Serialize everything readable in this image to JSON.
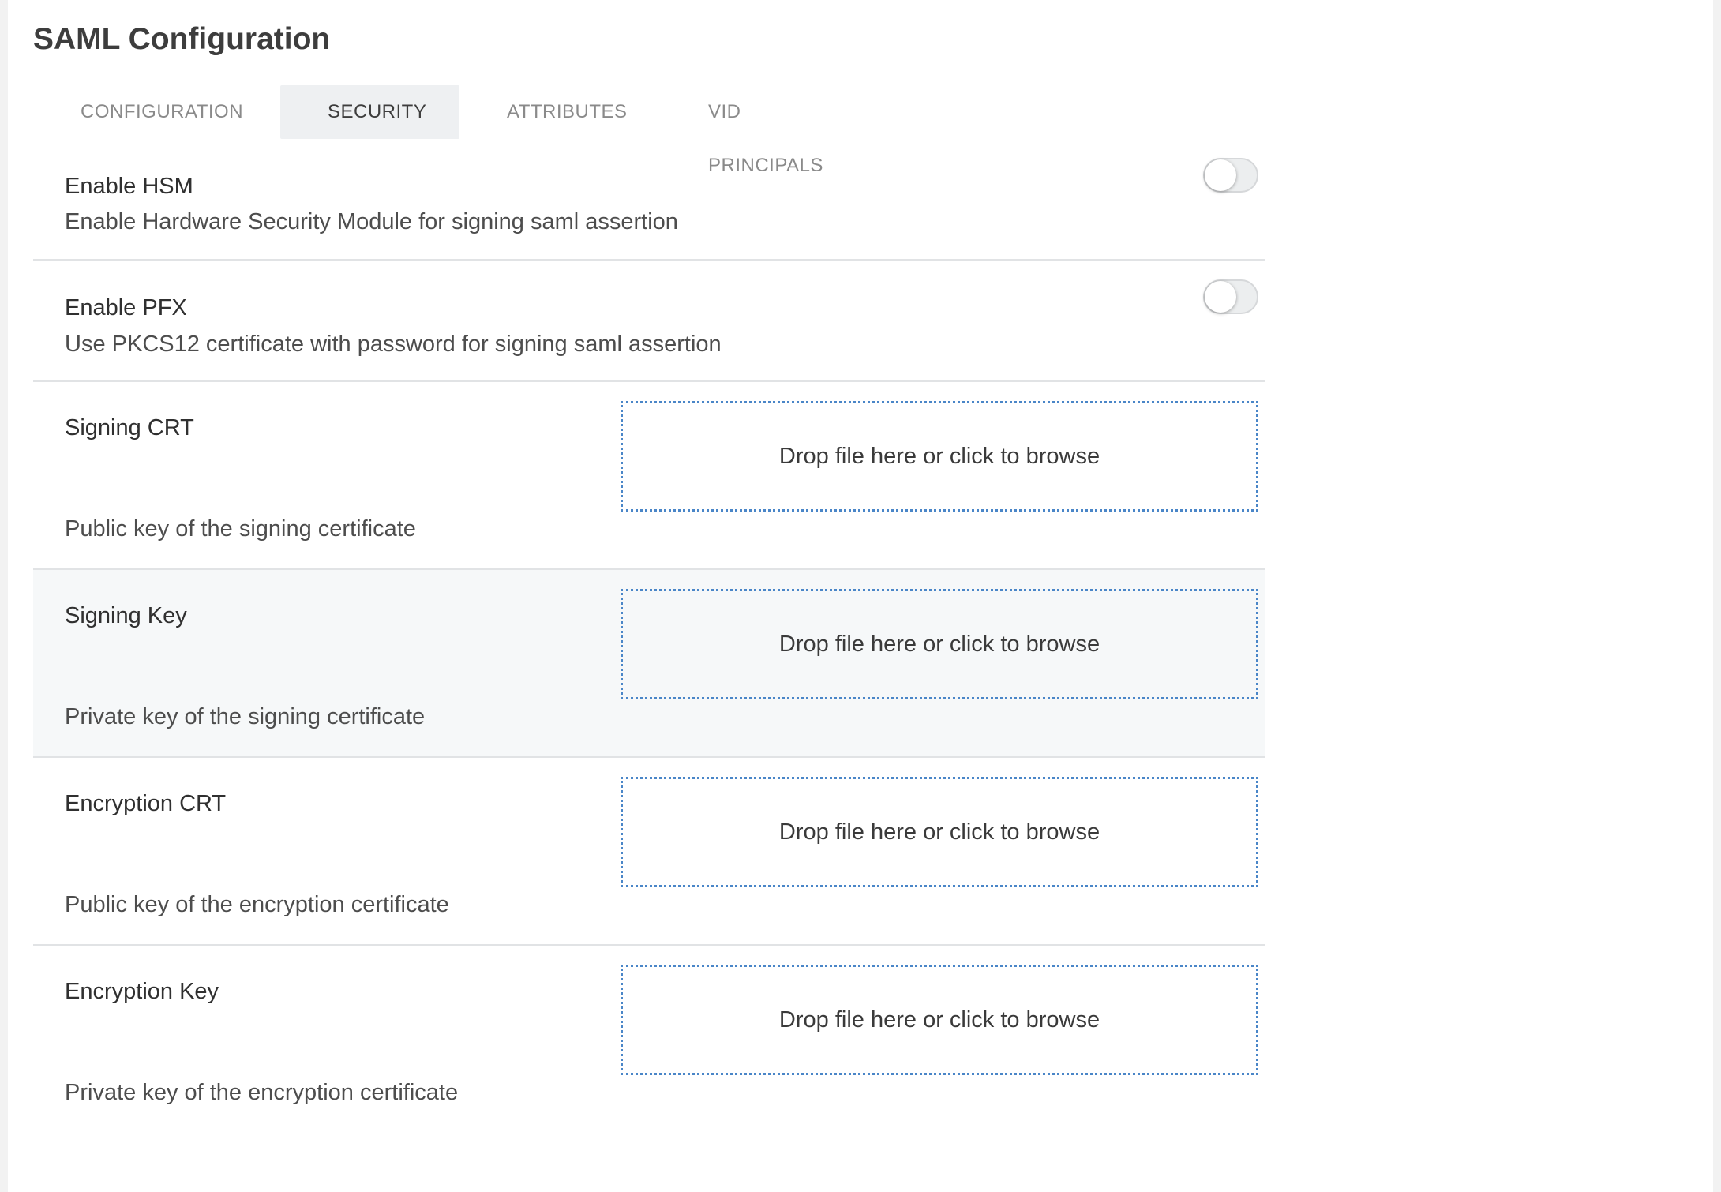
{
  "page": {
    "title": "SAML Configuration"
  },
  "tabs": [
    {
      "label": "CONFIGURATION",
      "active": false
    },
    {
      "label": "SECURITY",
      "active": true
    },
    {
      "label": "ATTRIBUTES",
      "active": false
    },
    {
      "label": "VID PRINCIPALS",
      "active": false
    }
  ],
  "settings": {
    "hsm": {
      "label": "Enable HSM",
      "description": "Enable Hardware Security Module for signing saml assertion",
      "enabled": false
    },
    "pfx": {
      "label": "Enable PFX",
      "description": "Use PKCS12 certificate with password for signing saml assertion",
      "enabled": false
    },
    "signing_crt": {
      "label": "Signing CRT",
      "description": "Public key of the signing certificate",
      "dropzone": "Drop file here or click to browse"
    },
    "signing_key": {
      "label": "Signing Key",
      "description": "Private key of the signing certificate",
      "dropzone": "Drop file here or click to browse"
    },
    "encryption_crt": {
      "label": "Encryption CRT",
      "description": "Public key of the encryption certificate",
      "dropzone": "Drop file here or click to browse"
    },
    "encryption_key": {
      "label": "Encryption Key",
      "description": "Private key of the encryption certificate",
      "dropzone": "Drop file here or click to browse"
    }
  },
  "colors": {
    "accent_dotted_border": "#4a86c8",
    "active_tab_bg": "#eef0f2",
    "shaded_row_bg": "#f6f8f9"
  }
}
